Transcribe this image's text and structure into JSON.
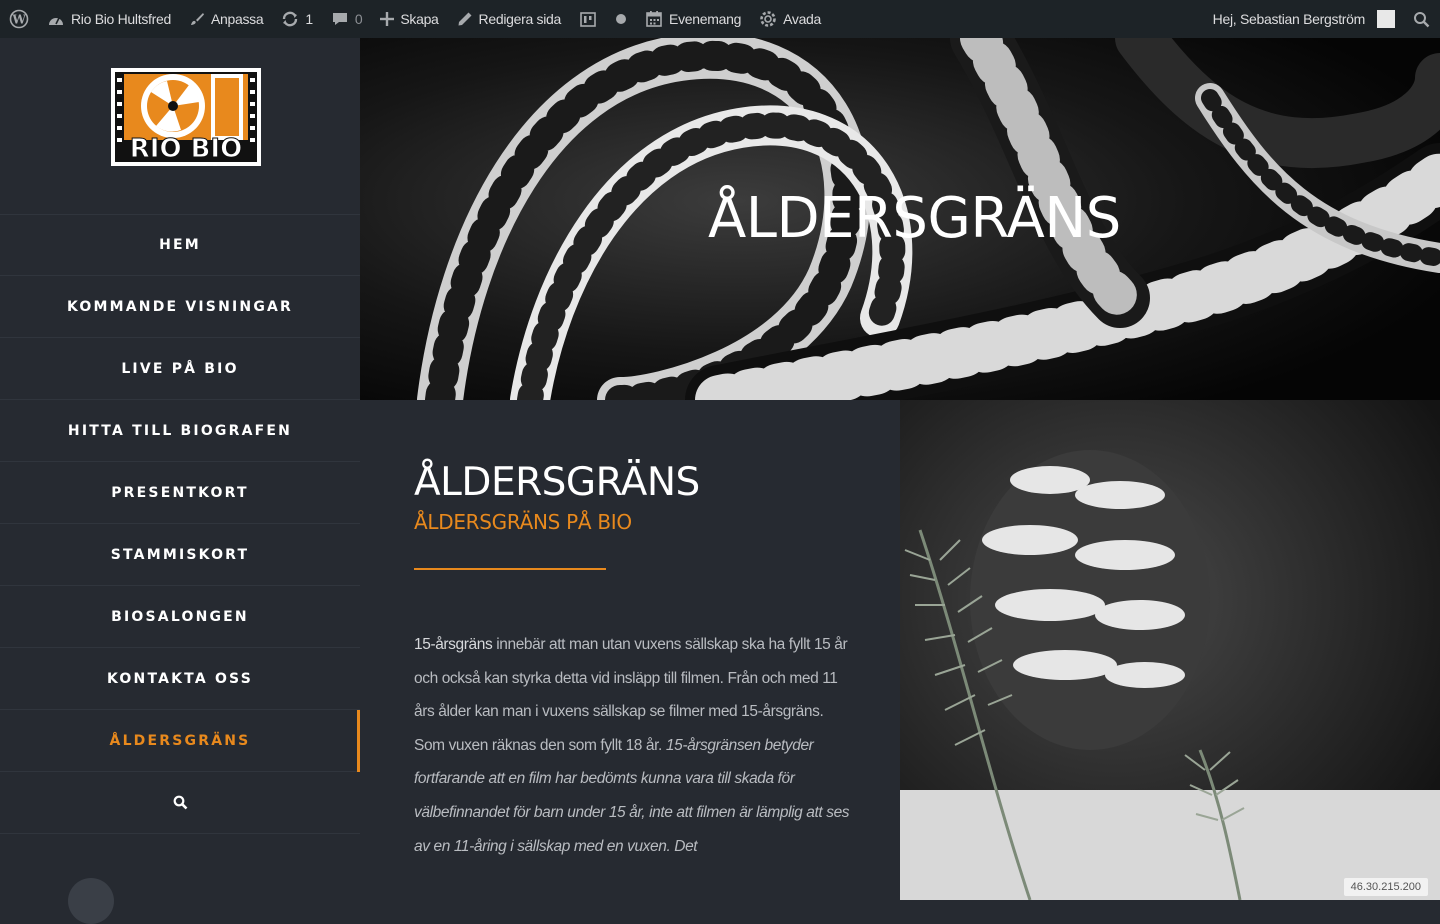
{
  "adminbar": {
    "site_name": "Rio Bio Hultsfred",
    "customize": "Anpassa",
    "updates_count": "1",
    "comments_count": "0",
    "new": "Skapa",
    "edit_page": "Redigera sida",
    "events": "Evenemang",
    "theme": "Avada",
    "greeting": "Hej, Sebastian Bergström"
  },
  "logo": {
    "text": "RIO BIO",
    "accent": "#e8891d"
  },
  "menu": {
    "items": [
      {
        "label": "HEM"
      },
      {
        "label": "KOMMANDE VISNINGAR"
      },
      {
        "label": "LIVE PÅ BIO"
      },
      {
        "label": "HITTA TILL BIOGRAFEN"
      },
      {
        "label": "PRESENTKORT"
      },
      {
        "label": "STAMMISKORT"
      },
      {
        "label": "BIOSALONGEN"
      },
      {
        "label": "KONTAKTA OSS"
      },
      {
        "label": "ÅLDERSGRÄNS"
      }
    ],
    "active_color": "#e8891d"
  },
  "hero": {
    "title": "ÅLDERSGRÄNS"
  },
  "content": {
    "title": "ÅLDERSGRÄNS",
    "subtitle": "ÅLDERSGRÄNS PÅ BIO",
    "lead": "15-årsgräns",
    "body_plain": " innebär att man utan vuxens sällskap ska ha fyllt 15 år och också kan styrka detta vid insläpp till filmen. Från och med 11 års ålder kan man i vuxens sällskap se filmer med 15-årsgräns. Som vuxen räknas den som fyllt 18 år. ",
    "body_italic": "15-årsgränsen betyder fortfarande att en film har bedömts kunna vara till skada för välbefinnandet för barn under 15 år, inte att filmen är lämplig att ses av en 11-åring i sällskap med en vuxen. Det"
  },
  "badge": {
    "ip": "46.30.215.200"
  }
}
